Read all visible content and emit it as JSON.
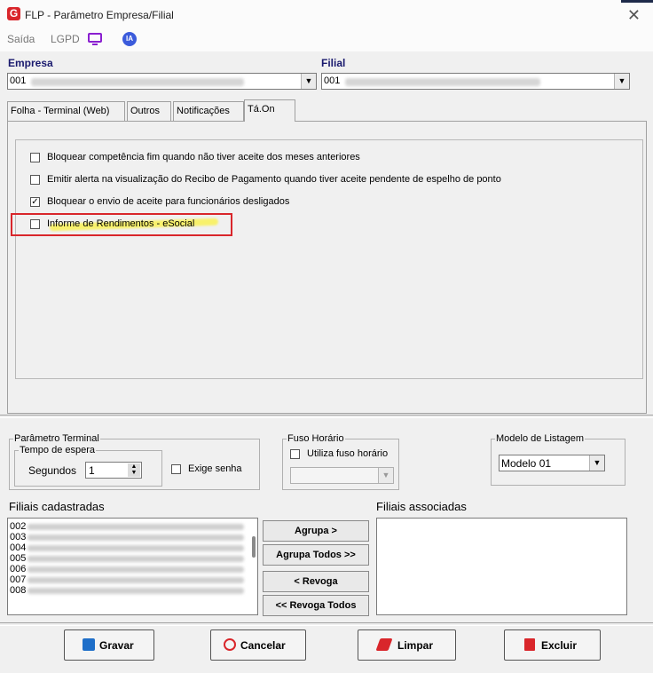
{
  "window": {
    "title": "FLP - Parâmetro Empresa/Filial"
  },
  "toolbar": {
    "saida": "Saída",
    "lgpd": "LGPD",
    "ia": "IA"
  },
  "empresa": {
    "label": "Empresa",
    "value": "001"
  },
  "filial": {
    "label": "Filial",
    "value": "001"
  },
  "tabs": [
    {
      "label": "Folha - Terminal (Web)"
    },
    {
      "label": "Outros"
    },
    {
      "label": "Notificações"
    },
    {
      "label": "Tá.On"
    }
  ],
  "options": [
    {
      "label": "Bloquear competência fim quando não tiver aceite dos meses anteriores",
      "checked": false
    },
    {
      "label": "Emitir alerta na visualização do Recibo de Pagamento quando tiver aceite pendente de espelho de ponto",
      "checked": false
    },
    {
      "label": "Bloquear o envio de aceite para funcionários desligados",
      "checked": true
    },
    {
      "label": "Informe de Rendimentos - eSocial",
      "checked": false
    }
  ],
  "parametro_terminal": {
    "legend": "Parâmetro Terminal",
    "tempo_legend": "Tempo de espera",
    "segundos_label": "Segundos",
    "segundos_value": "1",
    "exige_senha": "Exige senha"
  },
  "fuso": {
    "legend": "Fuso Horário",
    "utiliza": "Utiliza fuso horário"
  },
  "modelo": {
    "legend": "Modelo de Listagem",
    "value": "Modelo 01"
  },
  "filiais_cadastradas": {
    "label": "Filiais cadastradas",
    "items": [
      "002",
      "003",
      "004",
      "005",
      "006",
      "007",
      "008"
    ]
  },
  "filiais_associadas": {
    "label": "Filiais associadas"
  },
  "move_buttons": {
    "agrupa": "Agrupa >",
    "agrupa_todos": "Agrupa Todos >>",
    "revoga": "< Revoga",
    "revoga_todos": "<< Revoga Todos"
  },
  "actions": {
    "gravar": "Gravar",
    "cancelar": "Cancelar",
    "limpar": "Limpar",
    "excluir": "Excluir"
  },
  "colors": {
    "accent_red": "#d9262b",
    "highlight_yellow": "#fff200",
    "label_blue": "#1a1a6e"
  }
}
